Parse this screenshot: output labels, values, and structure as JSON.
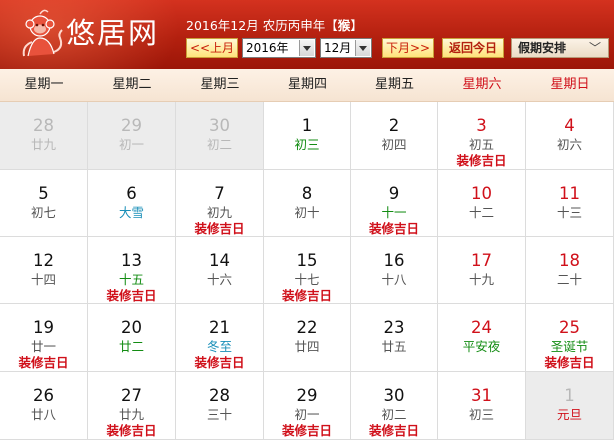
{
  "header": {
    "site_name": "悠居网",
    "date_line_prefix": "2016年12月 农历丙申年【",
    "zodiac": "猴",
    "date_line_suffix": "】",
    "prev_label": "<<上月",
    "year_value": "2016年",
    "month_value": "12月",
    "next_label": "下月>>",
    "today_label": "返回今日",
    "holiday_label": "假期安排",
    "holiday_chevron": "﹀"
  },
  "icons": {
    "logo": "monkey-zodiac-icon",
    "dropdown": "triangle-down-icon"
  },
  "colors": {
    "header_red": "#b3200f",
    "weekend_red": "#d0101a",
    "term_blue": "#1a8fb8",
    "festival_green": "#138c13"
  },
  "weekdays": [
    "星期一",
    "星期二",
    "星期三",
    "星期四",
    "星期五",
    "星期六",
    "星期日"
  ],
  "weeks": [
    [
      {
        "day": "28",
        "lunar": "廿九",
        "other": true
      },
      {
        "day": "29",
        "lunar": "初一",
        "other": true
      },
      {
        "day": "30",
        "lunar": "初二",
        "other": true
      },
      {
        "day": "1",
        "lunar": "初三",
        "lunar_style": "holiday"
      },
      {
        "day": "2",
        "lunar": "初四"
      },
      {
        "day": "3",
        "lunar": "初五",
        "tag": "装修吉日"
      },
      {
        "day": "4",
        "lunar": "初六"
      }
    ],
    [
      {
        "day": "5",
        "lunar": "初七"
      },
      {
        "day": "6",
        "lunar": "大雪",
        "lunar_style": "term"
      },
      {
        "day": "7",
        "lunar": "初九",
        "tag": "装修吉日"
      },
      {
        "day": "8",
        "lunar": "初十"
      },
      {
        "day": "9",
        "lunar": "十一",
        "lunar_style": "holiday",
        "tag": "装修吉日"
      },
      {
        "day": "10",
        "lunar": "十二"
      },
      {
        "day": "11",
        "lunar": "十三"
      }
    ],
    [
      {
        "day": "12",
        "lunar": "十四"
      },
      {
        "day": "13",
        "lunar": "十五",
        "lunar_style": "holiday",
        "tag": "装修吉日"
      },
      {
        "day": "14",
        "lunar": "十六"
      },
      {
        "day": "15",
        "lunar": "十七",
        "tag": "装修吉日"
      },
      {
        "day": "16",
        "lunar": "十八"
      },
      {
        "day": "17",
        "lunar": "十九"
      },
      {
        "day": "18",
        "lunar": "二十"
      }
    ],
    [
      {
        "day": "19",
        "lunar": "廿一",
        "tag": "装修吉日"
      },
      {
        "day": "20",
        "lunar": "廿二",
        "lunar_style": "holiday"
      },
      {
        "day": "21",
        "lunar": "冬至",
        "lunar_style": "term",
        "tag": "装修吉日"
      },
      {
        "day": "22",
        "lunar": "廿四"
      },
      {
        "day": "23",
        "lunar": "廿五"
      },
      {
        "day": "24",
        "lunar": "平安夜",
        "lunar_style": "holiday"
      },
      {
        "day": "25",
        "lunar": "圣诞节",
        "lunar_style": "holiday",
        "tag": "装修吉日"
      }
    ],
    [
      {
        "day": "26",
        "lunar": "廿八"
      },
      {
        "day": "27",
        "lunar": "廿九",
        "tag": "装修吉日"
      },
      {
        "day": "28",
        "lunar": "三十"
      },
      {
        "day": "29",
        "lunar": "初一",
        "tag": "装修吉日"
      },
      {
        "day": "30",
        "lunar": "初二",
        "tag": "装修吉日"
      },
      {
        "day": "31",
        "lunar": "初三"
      },
      {
        "day": "1",
        "lunar": "元旦",
        "lunar_style": "red",
        "other": true
      }
    ]
  ]
}
